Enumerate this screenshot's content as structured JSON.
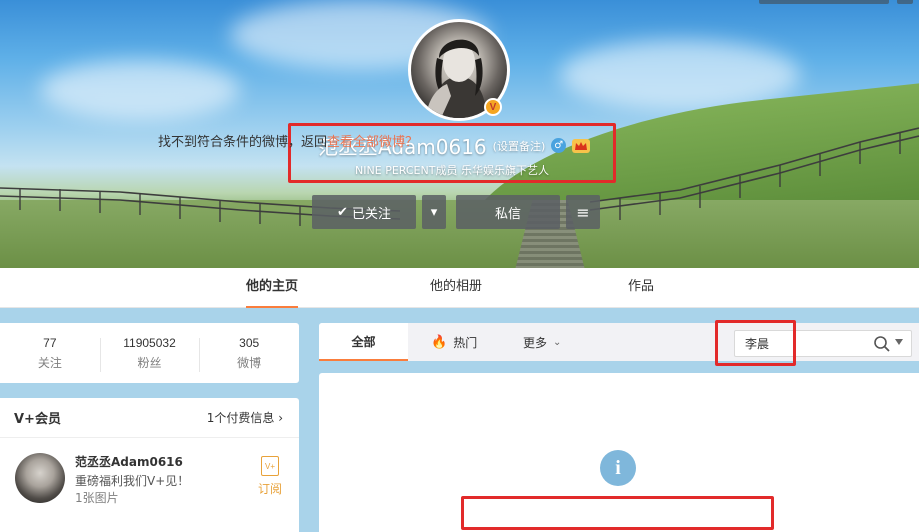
{
  "profile": {
    "nickname": "范丞丞Adam0616",
    "remark_link": "(设置备注)",
    "gender_symbol": "♂",
    "verified_badge": "V",
    "intro": "NINE PERCENT成员 乐华娱乐旗下艺人"
  },
  "actions": {
    "following_label": "已关注",
    "following_check": "✔",
    "dropdown_symbol": "▾",
    "message_label": "私信",
    "more_symbol": "≡"
  },
  "tabs": [
    {
      "label": "他的主页",
      "active": true
    },
    {
      "label": "他的相册",
      "active": false
    },
    {
      "label": "作品",
      "active": false
    }
  ],
  "stats": [
    {
      "number": "77",
      "label": "关注"
    },
    {
      "number": "11905032",
      "label": "粉丝"
    },
    {
      "number": "305",
      "label": "微博"
    }
  ],
  "vplus": {
    "title": "V+会员",
    "paid_link": "1个付费信息",
    "link_arrow": "›",
    "name": "范丞丞Adam0616",
    "desc": "重磅福利我们V+见！",
    "count": "1张图片",
    "subscribe_icon_text": "V+",
    "subscribe_label": "订阅"
  },
  "feed": {
    "tab_all": "全部",
    "tab_hot": "热门",
    "tab_more": "更多",
    "hot_icon": "🔥",
    "more_chevron": "⌄",
    "search_value": "李晨",
    "empty_icon": "i",
    "empty_text": "找不到符合条件的微博，返回",
    "empty_link": "查看全部微博？"
  },
  "colors": {
    "accent_orange": "#fa7d3c",
    "link_orange": "#eb7350",
    "highlight_red": "#e22a2a",
    "page_bg": "#a9d3ea"
  }
}
